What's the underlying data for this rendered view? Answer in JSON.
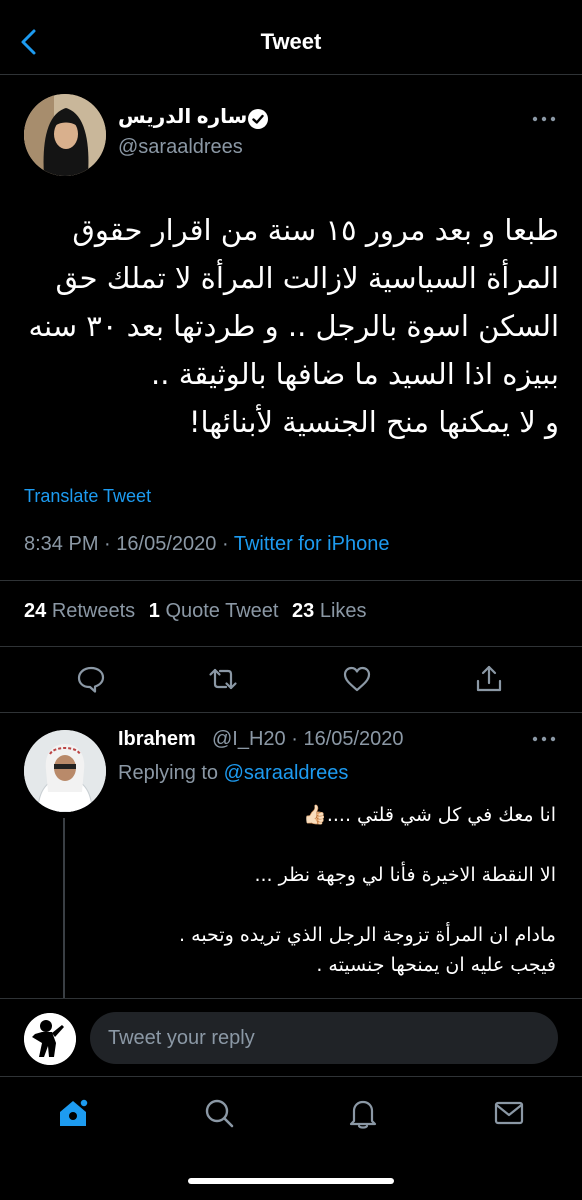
{
  "header": {
    "title": "Tweet",
    "back_icon": "chevron-left-icon"
  },
  "author": {
    "name": "ساره الدريس",
    "handle": "@saraaldrees",
    "verified": true,
    "more_icon": "more-horizontal-icon"
  },
  "tweet": {
    "lines": [
      "طبعا و بعد مرور ١٥ سنة من اقرار حقوق",
      "المرأة السياسية لازالت المرأة لا تملك حق",
      "السكن اسوة بالرجل .. و طردتها بعد ٣٠ سنه",
      "ببيزه اذا السيد ما ضافها بالوثيقة ..",
      "و لا يمكنها منح الجنسية لأبنائها!"
    ],
    "translate_label": "Translate Tweet",
    "time": "8:34 PM",
    "separator": "·",
    "date": "16/05/2020",
    "source": "Twitter for iPhone"
  },
  "stats": {
    "retweets_count": "24",
    "retweets_label": "Retweets",
    "quotes_count": "1",
    "quotes_label": "Quote Tweet",
    "likes_count": "23",
    "likes_label": "Likes"
  },
  "actions": [
    "reply-icon",
    "retweet-icon",
    "like-icon",
    "share-icon"
  ],
  "reply": {
    "name": "Ibrahem",
    "handle_time": "@I_H20 · 16/05/2020",
    "replying_prefix": "Replying to",
    "replying_handle": "@saraaldrees",
    "lines": [
      "انا معك في كل شي قلتي ....👍🏻",
      "",
      "الا النقطة الاخيرة فأنا لي وجهة نظر ...",
      "",
      "مادام ان المرأة تزوجة الرجل الذي تريده وتحبه .",
      "فيجب عليه ان يمنحها جنسيته ."
    ]
  },
  "composer": {
    "placeholder": "Tweet your reply"
  },
  "tabbar": [
    "home-icon",
    "search-icon",
    "notifications-icon",
    "messages-icon"
  ],
  "colors": {
    "accent": "#1d9bf0",
    "background": "#000000",
    "muted": "#8b98a5",
    "divider": "#2f3336"
  }
}
